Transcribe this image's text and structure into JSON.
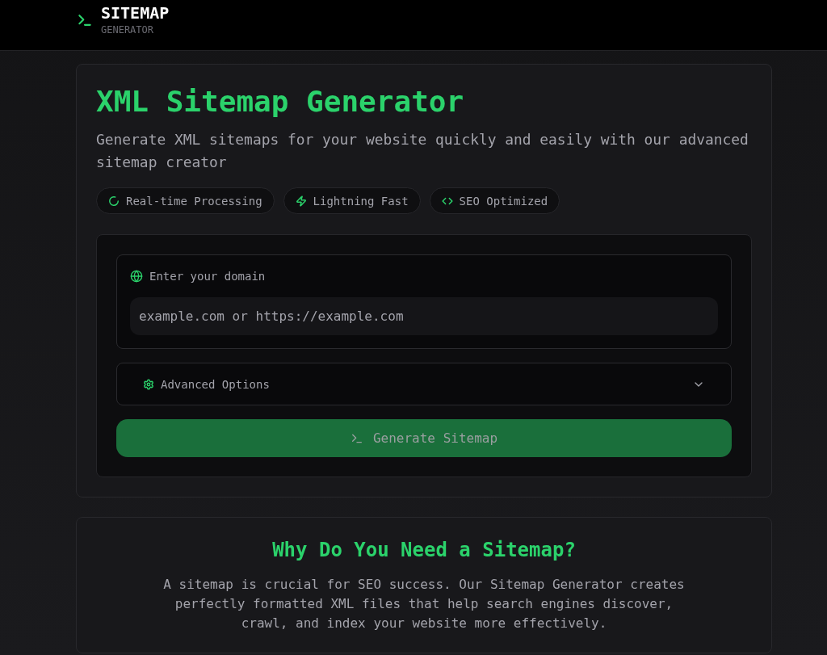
{
  "header": {
    "title": "SITEMAP",
    "subtitle": "GENERATOR"
  },
  "hero": {
    "title": "XML Sitemap Generator",
    "description": "Generate XML sitemaps for your website quickly and easily with our advanced sitemap creator",
    "features": [
      {
        "kind": "processing",
        "label": "Real-time Processing"
      },
      {
        "kind": "speed",
        "label": "Lightning Fast"
      },
      {
        "kind": "seo",
        "label": "SEO Optimized"
      }
    ]
  },
  "form": {
    "domain": {
      "label": "Enter your domain",
      "placeholder": "example.com or https://example.com"
    },
    "advanced": {
      "label": "Advanced Options",
      "expanded": false
    },
    "submit": {
      "label": "Generate Sitemap",
      "disabled": true
    }
  },
  "info": {
    "title": "Why Do You Need a Sitemap?",
    "text": "A sitemap is crucial for SEO success. Our Sitemap Generator creates perfectly formatted XML files that help search engines discover, crawl, and index your website more effectively."
  }
}
